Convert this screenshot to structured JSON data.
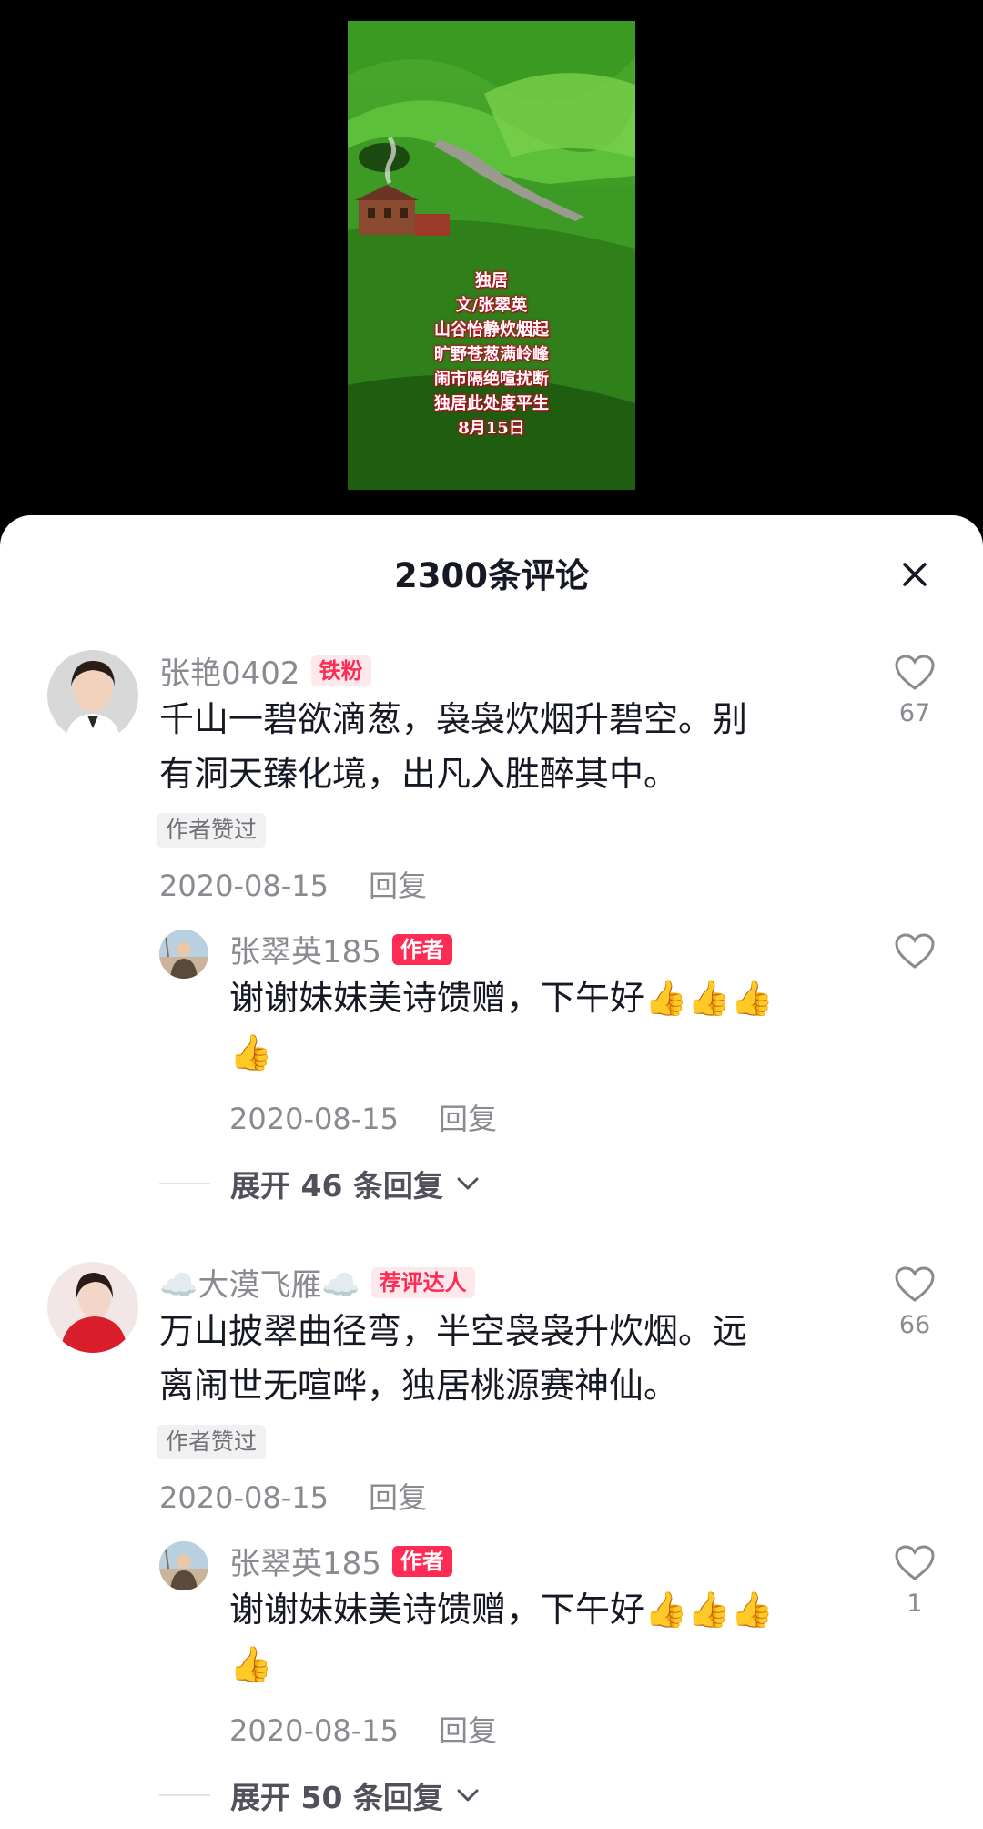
{
  "video": {
    "poem_lines": [
      "独居",
      "文/张翠英",
      "山谷怡静炊烟起",
      "旷野苍葱满岭峰",
      "闹市隔绝喧扰断",
      "独居此处度平生",
      "8月15日"
    ]
  },
  "sheet": {
    "title": "2300条评论",
    "close_icon": "close-icon"
  },
  "comments": [
    {
      "user": "张艳0402",
      "badge": "铁粉",
      "text_line1": "千山一碧欲滴葱，袅袅炊烟升碧空。别",
      "text_line2": "有洞天臻化境，出凡入胜醉其中。",
      "tag": "作者赞过",
      "date": "2020-08-15",
      "reply_label": "回复",
      "likes": "67",
      "reply": {
        "user": "张翠英185",
        "badge": "作者",
        "text_line1": "谢谢妹妹美诗馈赠，下午好👍👍👍",
        "text_line2": "👍",
        "date": "2020-08-15",
        "reply_label": "回复",
        "likes": ""
      },
      "expand_label": "展开 46 条回复"
    },
    {
      "user": "☁️大漠飞雁☁️",
      "badge": "荐评达人",
      "text_line1": "万山披翠曲径弯，半空袅袅升炊烟。远",
      "text_line2": "离闹世无喧哗，独居桃源赛神仙。",
      "tag": "作者赞过",
      "date": "2020-08-15",
      "reply_label": "回复",
      "likes": "66",
      "reply": {
        "user": "张翠英185",
        "badge": "作者",
        "text_line1": "谢谢妹妹美诗馈赠，下午好👍👍👍",
        "text_line2": "👍",
        "date": "2020-08-15",
        "reply_label": "回复",
        "likes": "1"
      },
      "expand_label": "展开 50 条回复"
    }
  ],
  "colors": {
    "accent": "#fe2c55",
    "text": "#161823",
    "muted": "#8a8b91"
  }
}
